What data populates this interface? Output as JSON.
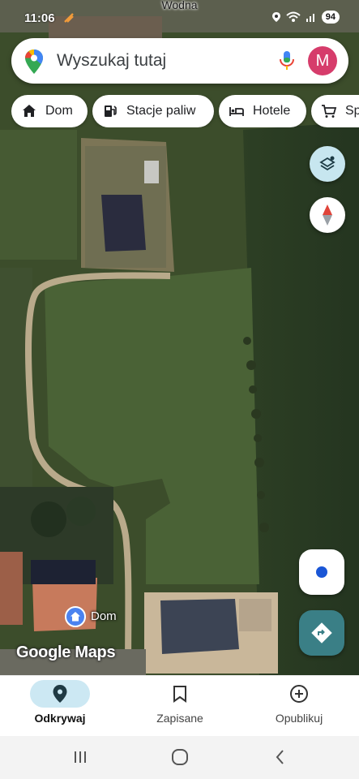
{
  "map": {
    "street_label": "Wodna",
    "place_label": "Dom",
    "attribution": "Google Maps"
  },
  "status_bar": {
    "time": "11:06",
    "battery": "94"
  },
  "search": {
    "placeholder": "Wyszukaj tutaj",
    "avatar_letter": "M"
  },
  "chips": [
    {
      "label": "Dom",
      "icon": "home-icon"
    },
    {
      "label": "Stacje paliw",
      "icon": "gas-station-icon"
    },
    {
      "label": "Hotele",
      "icon": "hotel-bed-icon"
    },
    {
      "label": "Sp",
      "icon": "shopping-cart-icon"
    }
  ],
  "bottom_nav": [
    {
      "label": "Odkrywaj",
      "icon": "explore-pin-icon",
      "active": true
    },
    {
      "label": "Zapisane",
      "icon": "bookmark-icon",
      "active": false
    },
    {
      "label": "Opublikuj",
      "icon": "add-circle-icon",
      "active": false
    }
  ],
  "colors": {
    "avatar": "#d63c6b",
    "active_nav": "#cce8f3",
    "directions_button": "#3a7f86",
    "layers_button": "#c7e6ef",
    "home_marker": "#4b83f0"
  }
}
